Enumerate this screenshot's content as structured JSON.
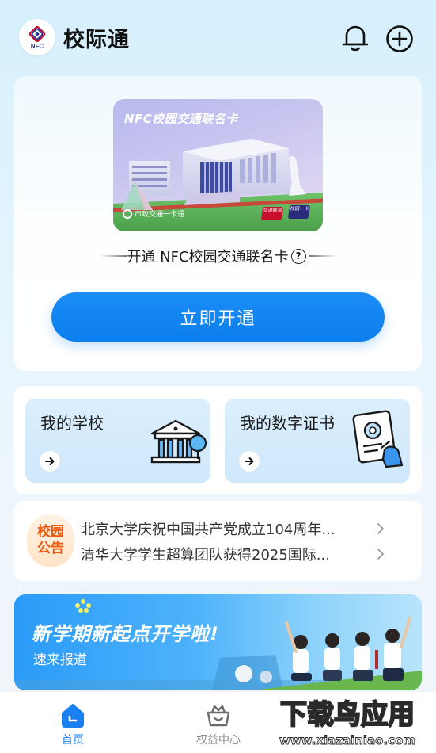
{
  "header": {
    "title": "校际通",
    "logo_text": "NFC",
    "icons": [
      "bell-icon",
      "plus-circle-icon"
    ]
  },
  "nfc_section": {
    "card_title": "NFC校园交通联名卡",
    "card_footer": "市政交通一卡通",
    "card_badge_a": "交通联合",
    "card_badge_b": "校园一卡",
    "open_label": "开通 NFC校园交通联名卡",
    "help_symbol": "?",
    "open_button": "立即开通"
  },
  "tiles": [
    {
      "title": "我的学校"
    },
    {
      "title": "我的数字证书"
    }
  ],
  "notice": {
    "badge_line1": "校园",
    "badge_line2": "公告",
    "items": [
      {
        "text": "北京大学庆祝中国共产党成立104周年..."
      },
      {
        "text": "清华大学学生超算团队获得2025国际..."
      }
    ]
  },
  "banner": {
    "title": "新学期新起点开学啦!",
    "subtitle": "速来报道"
  },
  "tabbar": {
    "items": [
      {
        "label": "首页",
        "active": true
      },
      {
        "label": "权益中心",
        "active": false
      }
    ]
  },
  "watermark": {
    "text": "下载鸟应用",
    "url": "www.xiazainiao.com"
  },
  "colors": {
    "primary": "#0c7eee",
    "notice_accent": "#ee5a10",
    "tile_bg": "#d6edfc"
  }
}
